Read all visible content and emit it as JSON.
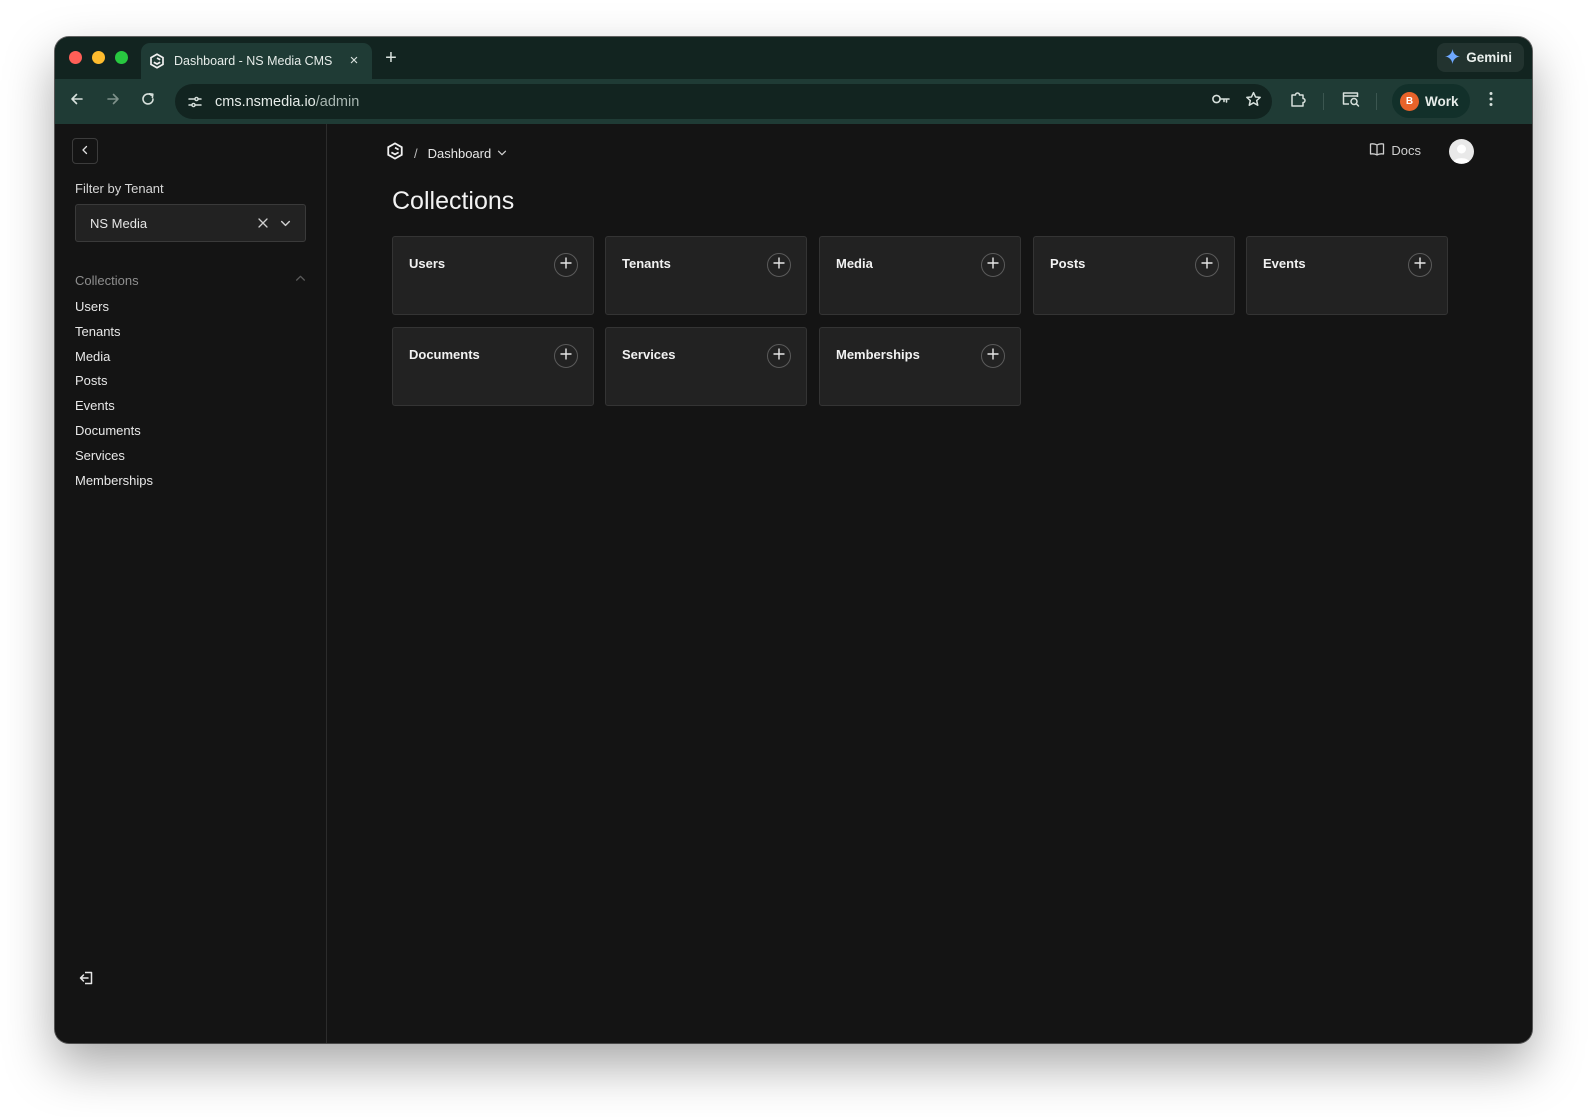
{
  "browser": {
    "tab_title": "Dashboard - NS Media CMS",
    "new_tab_symbol": "+",
    "close_symbol": "×",
    "gemini_label": "Gemini",
    "url_host": "cms.nsmedia.io",
    "url_path": "/admin",
    "profile_initial": "B",
    "profile_label": "Work"
  },
  "sidebar": {
    "filter_label": "Filter by Tenant",
    "tenant_value": "NS Media",
    "group_label": "Collections",
    "items": [
      "Users",
      "Tenants",
      "Media",
      "Posts",
      "Events",
      "Documents",
      "Services",
      "Memberships"
    ]
  },
  "header": {
    "breadcrumb_separator": "/",
    "breadcrumb_current": "Dashboard",
    "docs_label": "Docs"
  },
  "main": {
    "title": "Collections",
    "cards": [
      "Users",
      "Tenants",
      "Media",
      "Posts",
      "Events",
      "Documents",
      "Services",
      "Memberships"
    ]
  },
  "icons": {
    "tab_favicon": "cms-logo-icon",
    "gemini": "gemini-sparkle-icon",
    "back": "arrow-left-icon",
    "forward": "arrow-right-icon",
    "reload": "reload-icon",
    "site_info": "site-settings-icon",
    "password": "key-icon",
    "bookmark": "star-icon",
    "extensions": "puzzle-icon",
    "tab_search": "tab-search-icon",
    "menu": "kebab-menu-icon",
    "collapse": "chevron-left-icon",
    "clear": "close-icon",
    "dropdown": "chevron-down-icon",
    "group_toggle": "chevron-up-icon",
    "logout": "logout-icon",
    "logo": "cms-logo-icon",
    "docs": "book-icon",
    "add": "plus-icon"
  },
  "colors": {
    "page_bg": "#141414",
    "card_bg": "#222222",
    "browser_chrome": "#1f3b35",
    "tab_strip": "#122420",
    "profile_accent": "#e8632a"
  }
}
